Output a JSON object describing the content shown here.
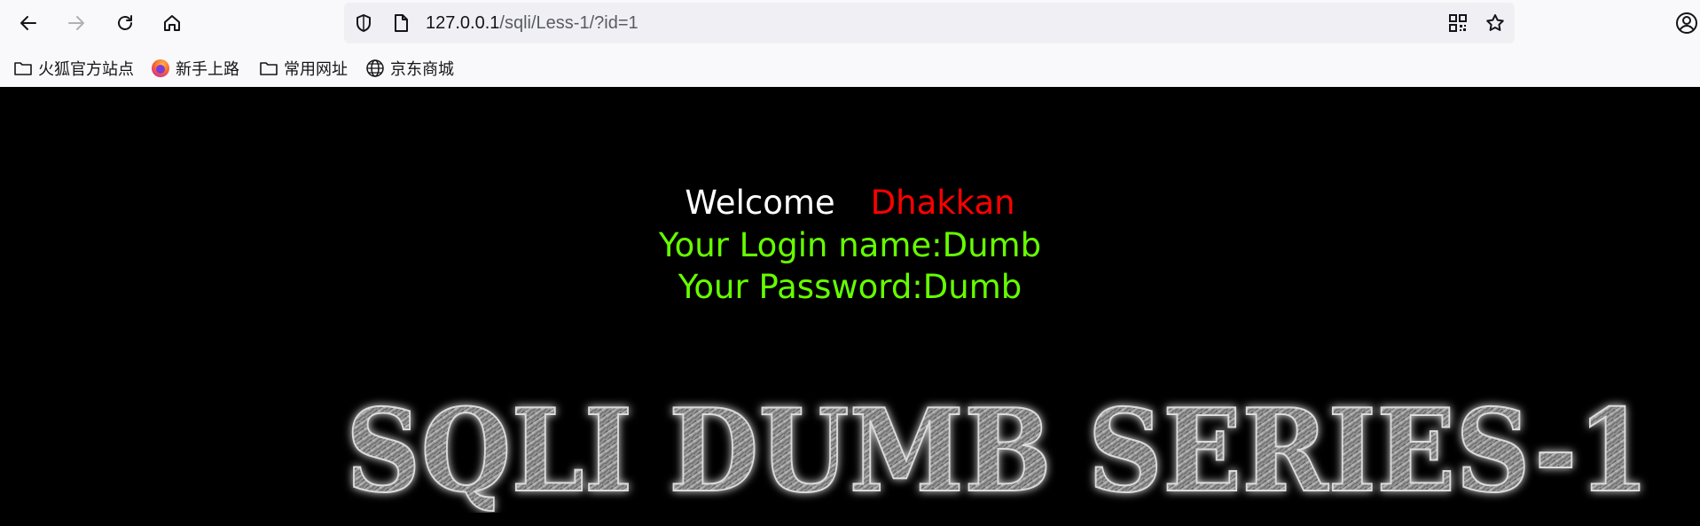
{
  "browser": {
    "url_host": "127.0.0.1",
    "url_path": "/sqli/Less-1/?id=1",
    "bookmarks": [
      {
        "label": "火狐官方站点",
        "icon": "folder-icon"
      },
      {
        "label": "新手上路",
        "icon": "firefox-icon"
      },
      {
        "label": "常用网址",
        "icon": "folder-icon"
      },
      {
        "label": "京东商城",
        "icon": "globe-icon"
      }
    ]
  },
  "page": {
    "welcome": "Welcome",
    "name": "Dhakkan",
    "login_line": "Your Login name:Dumb",
    "password_line": "Your Password:Dumb",
    "banner_title": "SQLI DUMB SERIES-1"
  },
  "colors": {
    "background": "#000000",
    "welcome": "#ffffff",
    "name": "#ff0000",
    "credentials": "#66ff00"
  }
}
